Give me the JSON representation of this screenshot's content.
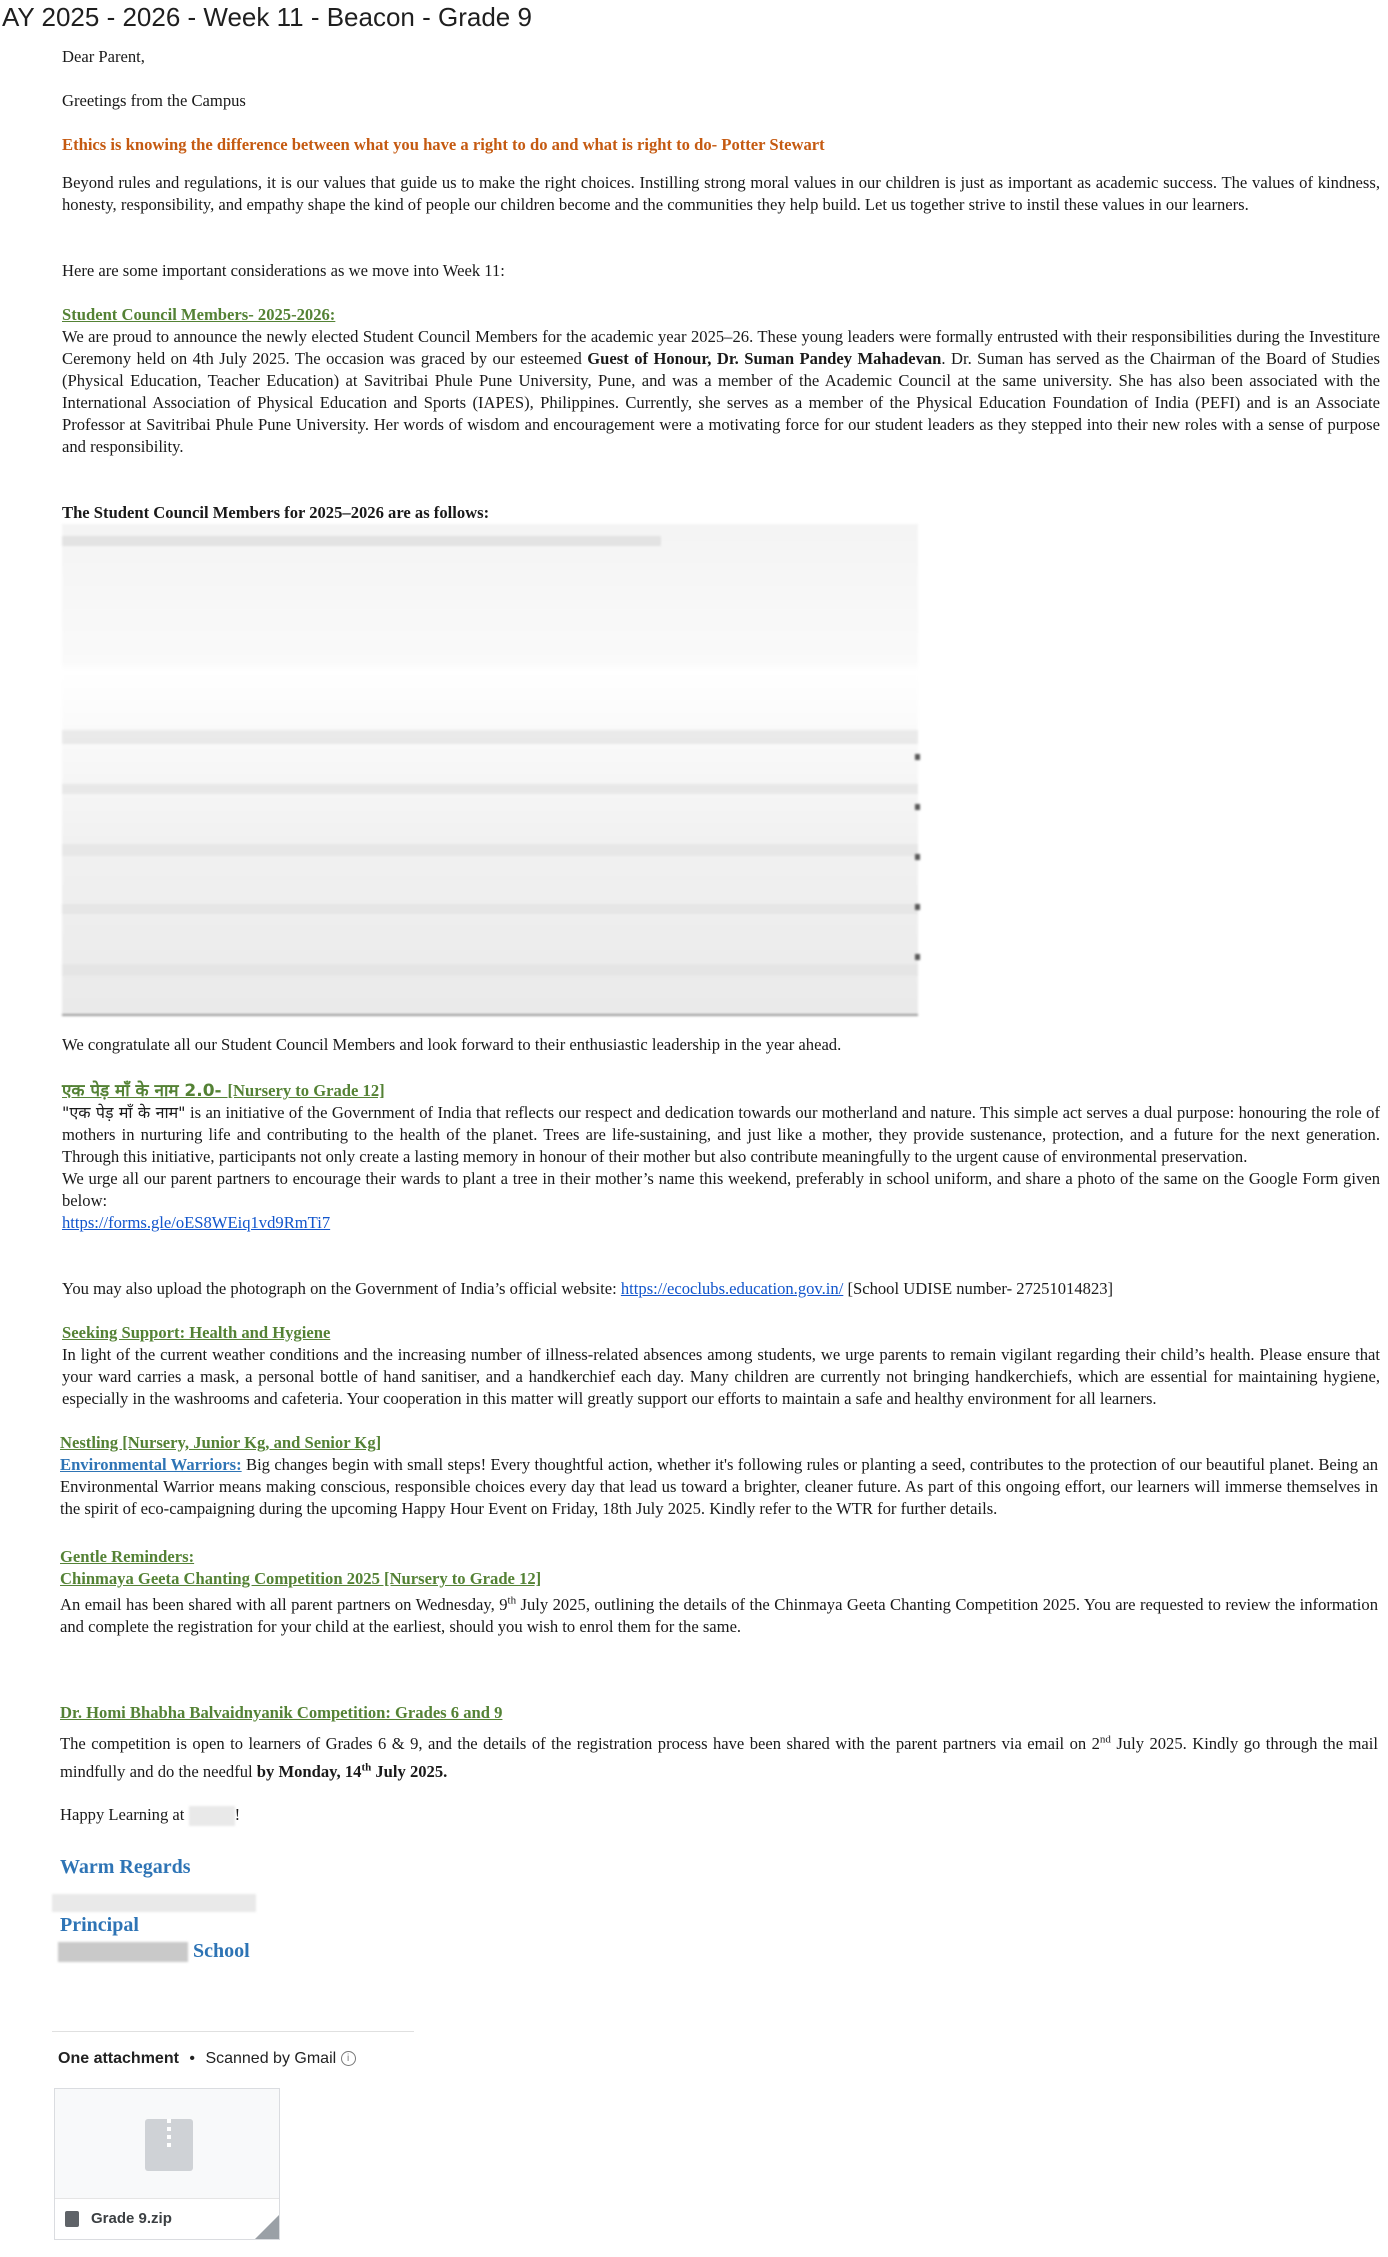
{
  "subject": "AY 2025 - 2026 - Week 11 - Beacon - Grade 9",
  "greeting": "Dear Parent,",
  "greeting2": "Greetings from the Campus",
  "quote": "Ethics is knowing the difference between what you have a right to do and what is right to do-  Potter Stewart",
  "intro": "Beyond rules and regulations, it is our values that guide us to make the right choices. Instilling strong moral values in our children is just as important as academic success. The values of kindness, honesty, responsibility, and empathy shape the kind of people our children become and the communities they help build. Let us together strive to instil these values in our learners.",
  "considerations": "Here are some important considerations as we move into Week 11:",
  "council": {
    "heading": "Student Council Members- 2025-2026:",
    "text_a": "We are proud to announce the newly elected Student Council Members for the academic year 2025–26. These young leaders were formally entrusted with their responsibilities during the Investiture Ceremony held on 4th July 2025. The occasion was graced by our esteemed ",
    "text_bold": "Guest of Honour, Dr. Suman Pandey Mahadevan",
    "text_b": ". Dr. Suman has served as the Chairman of the Board of Studies (Physical Education, Teacher Education) at Savitribai Phule Pune University, Pune, and was a member of the Academic Council at the same university. She has also been associated with the International Association of Physical Education and Sports (IAPES), Philippines. Currently, she serves as a member of the Physical Education Foundation of India (PEFI) and is an Associate Professor at Savitribai Phule Pune University. Her words of wisdom and encouragement were a motivating force for our student leaders as they stepped into their new roles with a sense of purpose and responsibility.",
    "members_heading": "The Student Council Members for 2025–2026 are as follows:",
    "congrats": "We congratulate all our Student Council Members and look forward to their enthusiastic leadership in the year ahead."
  },
  "tree": {
    "heading_hindi": "एक पेड़ माँ के नाम 2.0- ",
    "heading_range": "[Nursery to Grade 12]",
    "quote_hindi": "\"एक पेड़ माँ के नाम\"",
    "text": " is an initiative of the Government of India that reflects our respect and dedication towards our motherland and nature. This simple act serves a dual purpose: honouring the role of mothers in nurturing life and contributing to the health of the planet. Trees are life-sustaining, and just like a mother, they provide sustenance, protection, and a future for the next generation. Through this initiative, participants not only create a lasting memory in honour of their mother but also contribute meaningfully to the urgent cause of environmental preservation.",
    "urge": "We urge all our parent partners to encourage their wards to plant a tree in their mother’s name this weekend, preferably in school uniform, and share a photo of the same on the Google Form given below:",
    "form_link": "https://forms.gle/oES8WEiq1vd9RmTi7",
    "upload_a": "You may also upload the photograph on the Government of India’s official website: ",
    "upload_link": "https://ecoclubs.education.gov.in/",
    "upload_b": " [School UDISE number- 27251014823]"
  },
  "health": {
    "heading": "Seeking Support: Health and Hygiene",
    "text": "In light of the current weather conditions and the increasing number of illness-related absences among students, we urge parents to remain vigilant regarding their child’s health. Please ensure that your ward carries a mask, a personal bottle of hand sanitiser, and a handkerchief each day. Many children are currently not bringing handkerchiefs, which are essential for maintaining hygiene, especially in the washrooms and cafeteria. Your cooperation in this matter will greatly support our efforts to maintain a safe and healthy environment for all learners."
  },
  "nestling": {
    "heading": "Nestling [Nursery, Junior Kg, and Senior Kg]",
    "sub": "Environmental Warriors:",
    "text": " Big changes begin with small steps! Every thoughtful action, whether it's following rules or planting a seed, contributes to the protection of our beautiful planet. Being an Environmental Warrior means making conscious, responsible choices every day that lead us toward a brighter, cleaner future. As part of this ongoing effort, our learners will immerse themselves in the spirit of eco-campaigning during the upcoming Happy Hour Event on Friday, 18th July 2025. Kindly refer to the WTR for further details."
  },
  "reminders": {
    "heading": "Gentle Reminders:",
    "geeta_heading": "Chinmaya Geeta Chanting Competition 2025 [Nursery to Grade 12]",
    "geeta_a": "An email has been shared with all parent partners on Wednesday, 9",
    "geeta_sup": "th",
    "geeta_b": " July 2025, outlining the details of the Chinmaya Geeta Chanting Competition 2025. You are requested to review the information and complete the registration for your child at the earliest, should you wish to enrol them for the same.",
    "homi_heading": "Dr. Homi Bhabha Balvaidnyanik Competition: Grades 6 and 9",
    "homi_a": "The competition is open to learners of Grades 6 & 9, and the details of the registration process have been shared with the parent partners via email on 2",
    "homi_sup": "nd",
    "homi_b": " July 2025. Kindly go through the mail mindfully and do the needful ",
    "homi_bold_a": "by Monday, 14",
    "homi_bold_sup": "th",
    "homi_bold_b": " July 2025."
  },
  "closing": {
    "happy_a": "Happy Learning at ",
    "happy_b": "!",
    "regards": "Warm Regards",
    "principal": "Principal",
    "school": "School"
  },
  "attachment": {
    "count_label": "One attachment",
    "separator": "•",
    "scanned": "Scanned by Gmail",
    "info_glyph": "i",
    "file_name": "Grade 9.zip"
  }
}
